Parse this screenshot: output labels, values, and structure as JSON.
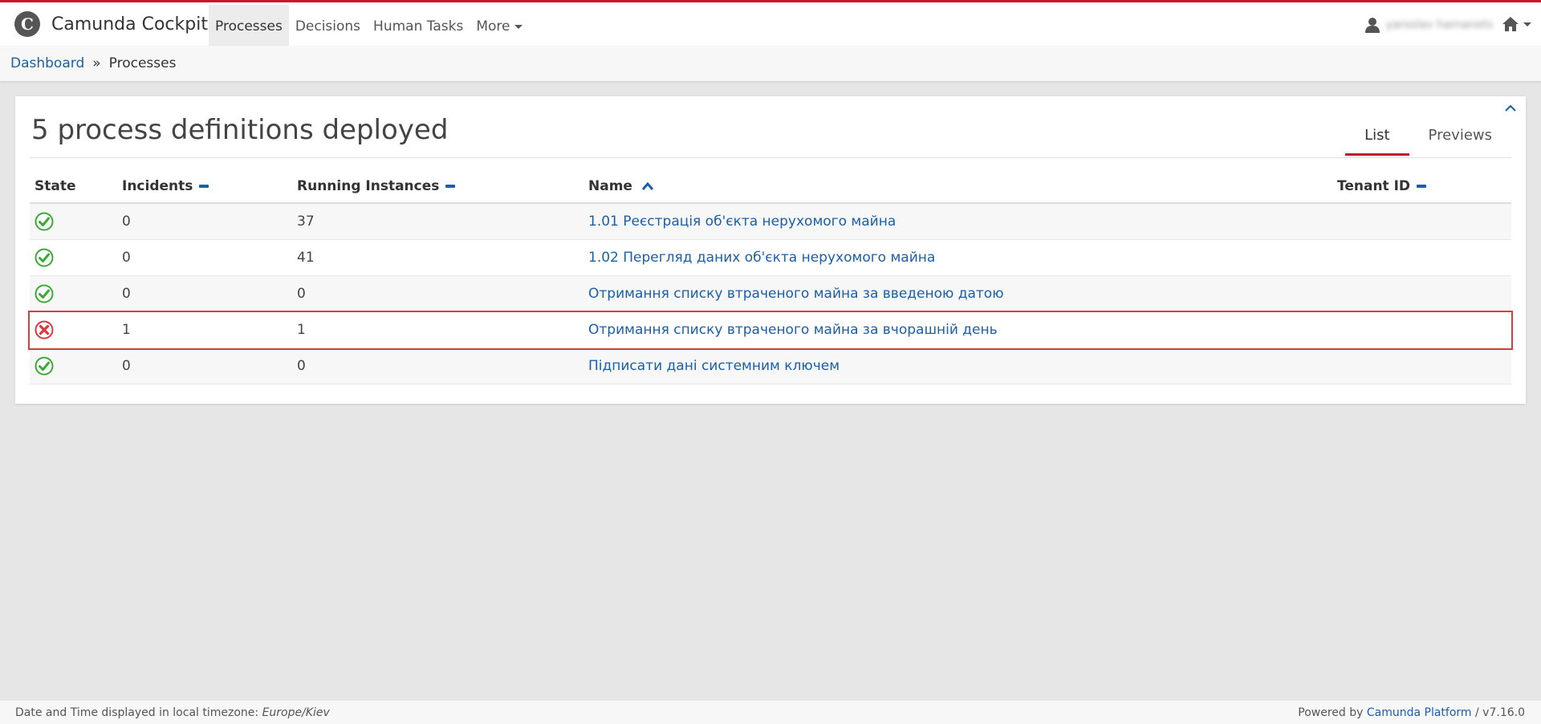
{
  "header": {
    "brand": "Camunda Cockpit",
    "nav": [
      {
        "label": "Processes",
        "active": true
      },
      {
        "label": "Decisions",
        "active": false
      },
      {
        "label": "Human Tasks",
        "active": false
      },
      {
        "label": "More",
        "active": false
      }
    ],
    "user_name": "yaroslav hamanets",
    "accent_color": "#c8102e"
  },
  "breadcrumb": {
    "root": "Dashboard",
    "separator": "»",
    "current": "Processes"
  },
  "panel": {
    "title": "5 process definitions deployed",
    "tabs": [
      {
        "label": "List",
        "active": true
      },
      {
        "label": "Previews",
        "active": false
      }
    ]
  },
  "table": {
    "headers": {
      "state": "State",
      "incidents": "Incidents",
      "running": "Running Instances",
      "name": "Name",
      "tenant": "Tenant ID"
    },
    "rows": [
      {
        "state": "ok",
        "incidents": "0",
        "running": "37",
        "name": "1.01 Реєстрація об'єкта нерухомого майна",
        "tenant": ""
      },
      {
        "state": "ok",
        "incidents": "0",
        "running": "41",
        "name": "1.02 Перегляд даних об'єкта нерухомого майна",
        "tenant": ""
      },
      {
        "state": "ok",
        "incidents": "0",
        "running": "0",
        "name": "Отримання списку втраченого майна за введеною датою",
        "tenant": ""
      },
      {
        "state": "error",
        "incidents": "1",
        "running": "1",
        "name": "Отримання списку втраченого майна за вчорашній день",
        "tenant": ""
      },
      {
        "state": "ok",
        "incidents": "0",
        "running": "0",
        "name": "Підписати дані системним ключем",
        "tenant": ""
      }
    ]
  },
  "footer": {
    "left_prefix": "Date and Time displayed in local timezone:",
    "timezone": "Europe/Kiev",
    "powered_by": "Powered by",
    "platform": "Camunda Platform",
    "version": "/ v7.16.0"
  },
  "icons": {
    "ok": "check-circle-icon",
    "error": "x-circle-icon"
  }
}
